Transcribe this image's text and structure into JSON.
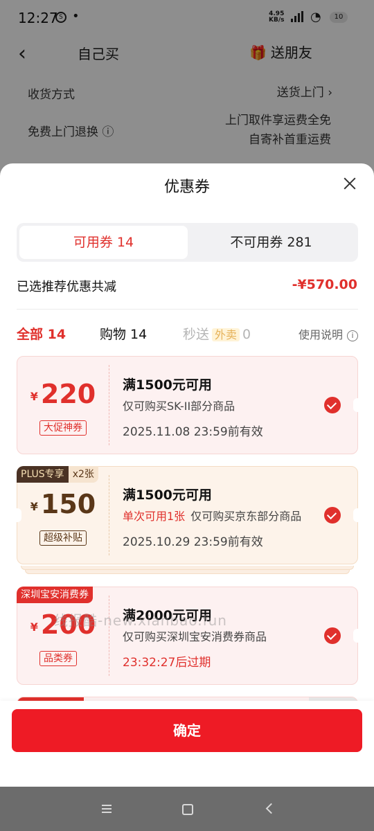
{
  "status_bar": {
    "time": "12:27",
    "speed_value": "4.95",
    "speed_unit": "KB/s",
    "battery": "10"
  },
  "background_page": {
    "tab_self": "自己买",
    "tab_gift": "送朋友",
    "rows": [
      {
        "label": "收货方式",
        "value": "送货上门"
      },
      {
        "label": "免费上门退换",
        "value_line1": "上门取件享运费全免",
        "value_line2": "自寄补首重运费"
      }
    ]
  },
  "sheet": {
    "title": "优惠券",
    "segments": {
      "available": "可用券 14",
      "unavailable": "不可用券 281"
    },
    "summary": {
      "label": "已选推荐优惠共减",
      "amount": "-¥570.00"
    },
    "filters": {
      "all": "全部 14",
      "shopping": "购物 14",
      "fast_prefix": "秒送",
      "fast_tag": "外卖",
      "fast_count": "0",
      "help": "使用说明"
    },
    "coupons": [
      {
        "currency": "¥",
        "amount": "220",
        "kind": "大促神券",
        "condition": "满1500元可用",
        "scope": "仅可购买SK-II部分商品",
        "expire": "2025.11.08 23:59前有效",
        "selected": true
      },
      {
        "badge_left": "PLUS专享",
        "badge_right": "x2张",
        "currency": "¥",
        "amount": "150",
        "kind": "超级补贴",
        "condition": "满1500元可用",
        "limit": "单次可用1张",
        "scope": "仅可购买京东部分商品",
        "expire": "2025.10.29 23:59前有效",
        "selected": true
      },
      {
        "badge": "深圳宝安消费券",
        "currency": "¥",
        "amount": "200",
        "kind": "品类券",
        "condition": "满2000元可用",
        "scope": "仅可购买深圳宝安消费券商品",
        "expire": "23:32:27后过期",
        "selected": true
      }
    ],
    "confirm": "确定"
  },
  "watermark": "线报酷-new.xianbao.fun"
}
